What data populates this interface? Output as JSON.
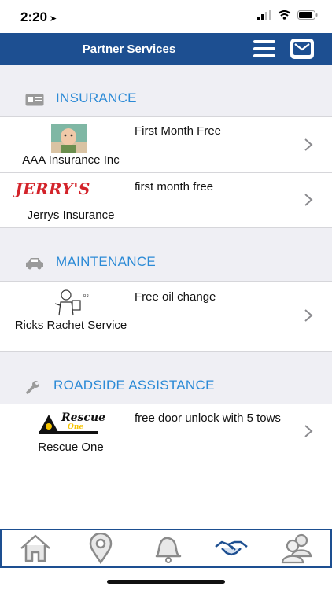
{
  "status_bar": {
    "time": "2:20"
  },
  "header": {
    "title": "Partner Services"
  },
  "sections": [
    {
      "title": "INSURANCE",
      "icon": "id-card-icon",
      "items": [
        {
          "name": "AAA Insurance Inc",
          "offer": "First Month Free",
          "logo": "baby-photo"
        },
        {
          "name": "Jerrys Insurance",
          "offer": "first month free",
          "logo_text": "JERRY'S"
        }
      ]
    },
    {
      "title": "MAINTENANCE",
      "icon": "car-icon",
      "items": [
        {
          "name": "Ricks Rachet Service",
          "offer": "Free oil change",
          "logo": "mechanic-sketch"
        }
      ]
    },
    {
      "title": "ROADSIDE ASSISTANCE",
      "icon": "wrench-icon",
      "items": [
        {
          "name": "Rescue One",
          "offer": "free door unlock with 5 tows",
          "logo_text": "Rescue",
          "logo_subtext": "One"
        }
      ]
    }
  ],
  "tabs": [
    {
      "name": "home",
      "icon": "home-icon"
    },
    {
      "name": "locations",
      "icon": "map-pin-icon"
    },
    {
      "name": "notifications",
      "icon": "bell-icon"
    },
    {
      "name": "partner-services",
      "icon": "handshake-icon",
      "active": true
    },
    {
      "name": "account",
      "icon": "users-icon"
    }
  ],
  "colors": {
    "nav": "#1d4f91",
    "section_title": "#2b8ad6",
    "list_bg": "#efeff4"
  }
}
